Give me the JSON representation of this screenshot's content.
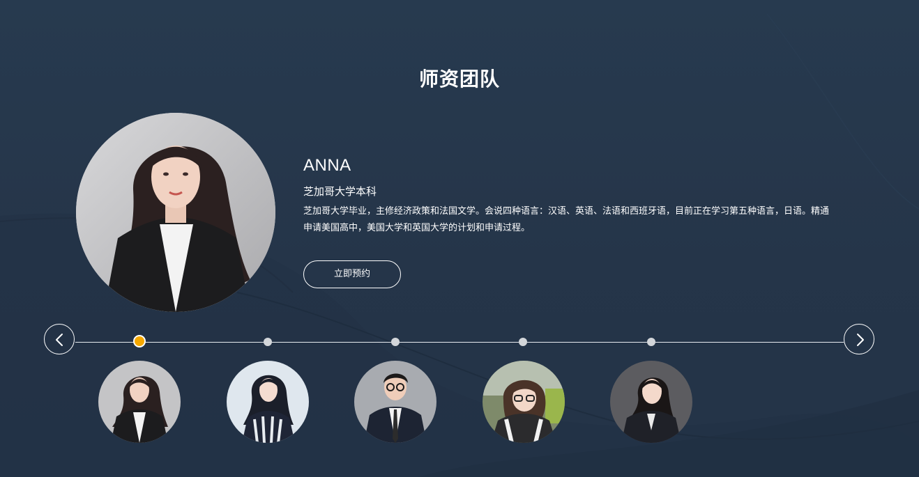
{
  "section": {
    "title": "师资团队"
  },
  "featured": {
    "name": "ANNA",
    "degree": "芝加哥大学本科",
    "bio": "芝加哥大学毕业，主修经济政策和法国文学。会说四种语言：汉语、英语、法语和西班牙语，目前正在学习第五种语言，日语。精通申请美国高中，美国大学和英国大学的计划和申请过程。",
    "button_label": "立即预约"
  },
  "carousel": {
    "prev_icon": "chevron-left-icon",
    "next_icon": "chevron-right-icon",
    "active_index": 0,
    "active_color": "#f5a800",
    "inactive_color": "#d3d6da"
  },
  "colors": {
    "background": "#25364b",
    "text": "#ffffff"
  }
}
